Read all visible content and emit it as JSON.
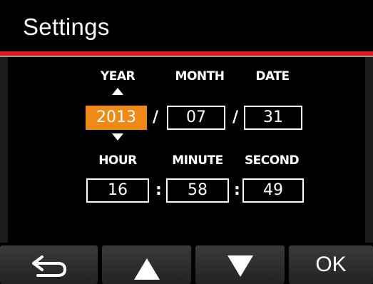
{
  "header": {
    "title": "Settings"
  },
  "date_labels": {
    "year": "YEAR",
    "month": "MONTH",
    "date": "DATE"
  },
  "time_labels": {
    "hour": "HOUR",
    "minute": "MINUTE",
    "second": "SECOND"
  },
  "date_values": {
    "year": "2013",
    "month": "07",
    "date": "31",
    "separator": "/"
  },
  "time_values": {
    "hour": "16",
    "minute": "58",
    "second": "49",
    "separator": ":"
  },
  "selected_field": "year",
  "footer": {
    "back_icon": "return-arrow-icon",
    "up_icon": "triangle-up-icon",
    "down_icon": "triangle-down-icon",
    "ok_label": "OK"
  },
  "colors": {
    "accent_line": "#e01a1a",
    "selected_field": "#f08a16",
    "background": "#000000",
    "button": "#2e2e2e"
  }
}
